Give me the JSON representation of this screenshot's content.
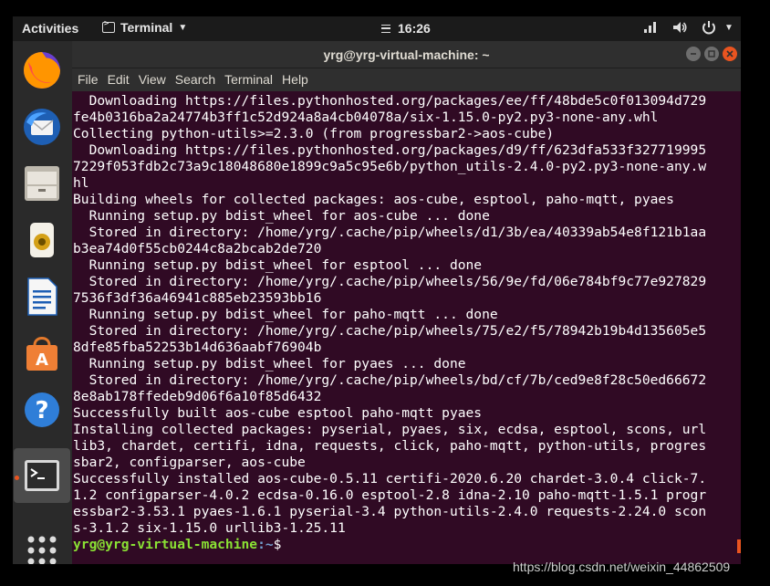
{
  "topbar": {
    "activities": "Activities",
    "app_name": "Terminal",
    "clock": "16:26"
  },
  "dock": {
    "items": [
      {
        "name": "Firefox"
      },
      {
        "name": "Thunderbird"
      },
      {
        "name": "Files"
      },
      {
        "name": "Rhythmbox"
      },
      {
        "name": "LibreOffice Writer"
      },
      {
        "name": "Ubuntu Software"
      },
      {
        "name": "Help"
      },
      {
        "name": "Terminal"
      },
      {
        "name": "Show Applications"
      }
    ]
  },
  "window": {
    "title": "yrg@yrg-virtual-machine: ~",
    "menu": [
      "File",
      "Edit",
      "View",
      "Search",
      "Terminal",
      "Help"
    ]
  },
  "terminal": {
    "lines": [
      "  Downloading https://files.pythonhosted.org/packages/ee/ff/48bde5c0f013094d729",
      "fe4b0316ba2a24774b3ff1c52d924a8a4cb04078a/six-1.15.0-py2.py3-none-any.whl",
      "Collecting python-utils>=2.3.0 (from progressbar2->aos-cube)",
      "  Downloading https://files.pythonhosted.org/packages/d9/ff/623dfa533f327719995",
      "7229f053fdb2c73a9c18048680e1899c9a5c95e6b/python_utils-2.4.0-py2.py3-none-any.w",
      "hl",
      "Building wheels for collected packages: aos-cube, esptool, paho-mqtt, pyaes",
      "  Running setup.py bdist_wheel for aos-cube ... done",
      "  Stored in directory: /home/yrg/.cache/pip/wheels/d1/3b/ea/40339ab54e8f121b1aa",
      "b3ea74d0f55cb0244c8a2bcab2de720",
      "  Running setup.py bdist_wheel for esptool ... done",
      "  Stored in directory: /home/yrg/.cache/pip/wheels/56/9e/fd/06e784bf9c77e927829",
      "7536f3df36a46941c885eb23593bb16",
      "  Running setup.py bdist_wheel for paho-mqtt ... done",
      "  Stored in directory: /home/yrg/.cache/pip/wheels/75/e2/f5/78942b19b4d135605e5",
      "8dfe85fba52253b14d636aabf76904b",
      "  Running setup.py bdist_wheel for pyaes ... done",
      "  Stored in directory: /home/yrg/.cache/pip/wheels/bd/cf/7b/ced9e8f28c50ed66672",
      "8e8ab178ffedeb9d06f6a10f85d6432",
      "Successfully built aos-cube esptool paho-mqtt pyaes",
      "Installing collected packages: pyserial, pyaes, six, ecdsa, esptool, scons, url",
      "lib3, chardet, certifi, idna, requests, click, paho-mqtt, python-utils, progres",
      "sbar2, configparser, aos-cube",
      "Successfully installed aos-cube-0.5.11 certifi-2020.6.20 chardet-3.0.4 click-7.",
      "1.2 configparser-4.0.2 ecdsa-0.16.0 esptool-2.8 idna-2.10 paho-mqtt-1.5.1 progr",
      "essbar2-3.53.1 pyaes-1.6.1 pyserial-3.4 python-utils-2.4.0 requests-2.24.0 scon",
      "s-3.1.2 six-1.15.0 urllib3-1.25.11"
    ],
    "prompt_user": "yrg@yrg-virtual-machine",
    "prompt_path": ":~",
    "prompt_symbol": "$"
  },
  "watermark": "https://blog.csdn.net/weixin_44862509"
}
